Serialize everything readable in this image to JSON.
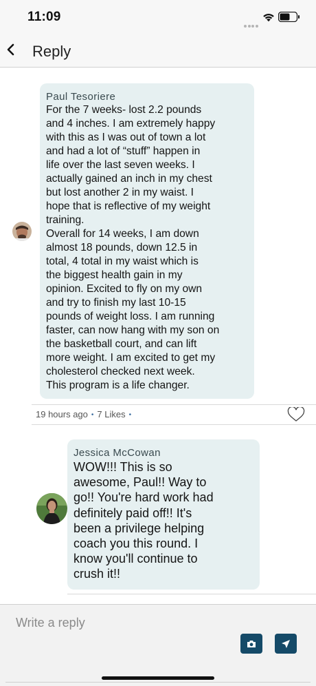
{
  "status_bar": {
    "time": "11:09"
  },
  "header": {
    "title": "Reply"
  },
  "comments": [
    {
      "author": "Paul Tesoriere",
      "text": "For the 7 weeks- lost 2.2 pounds\nand 4 inches. I am extremely happy\nwith this as I was out of town a lot\nand had a lot of “stuff” happen in\nlife over the last seven weeks. I\nactually gained an inch in my chest\nbut lost another 2 in my waist. I\nhope that is reflective of my weight\ntraining.\nOverall for 14 weeks, I am down\nalmost 18 pounds, down 12.5 in\ntotal, 4 total in my waist which is\nthe biggest health gain in my\nopinion. Excited to fly on my own\nand try to finish my last 10-15\npounds of weight loss. I am running\nfaster, can now hang with my son on\nthe basketball court, and can lift\nmore weight. I am excited to get my\ncholesterol checked next week.\nThis program is a life changer.",
      "time": "19 hours ago",
      "likes": "7 Likes",
      "separator": "•"
    },
    {
      "author": "Jessica McCowan",
      "text": "WOW!!! This is so\nawesome, Paul!! Way to\ngo!! You're hard work had\ndefinitely paid off!! It's\nbeen a privilege helping\ncoach you this round. I\nknow you'll continue to\ncrush it!!"
    }
  ],
  "composer": {
    "placeholder": "Write a reply"
  },
  "colors": {
    "bubble": "#e6f0f1",
    "accent": "#154a68",
    "dot": "#3d6ea0"
  },
  "icons": [
    "wifi-icon",
    "battery-icon",
    "back-arrow-icon",
    "heart-icon",
    "camera-icon",
    "send-icon"
  ]
}
